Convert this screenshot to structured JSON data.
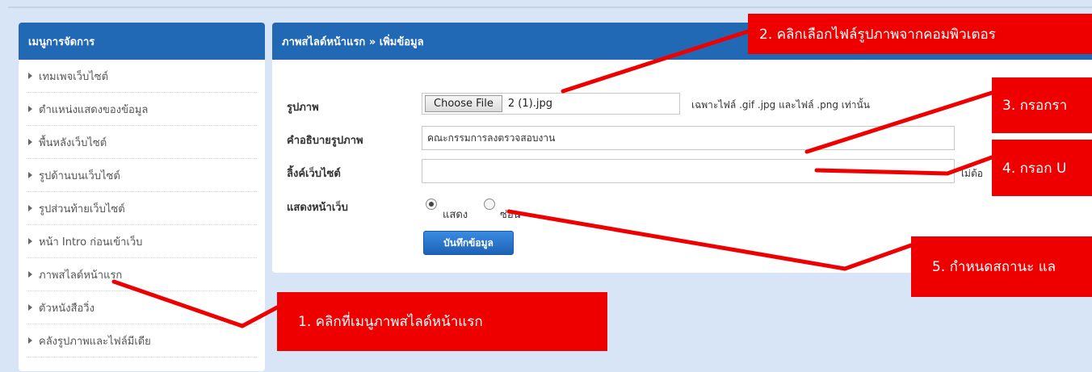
{
  "sidebar": {
    "title": "เมนูการจัดการ",
    "items": [
      {
        "label": "เทมเพจเว็บไซต์"
      },
      {
        "label": "ตำแหน่งแสดงของข้อมูล"
      },
      {
        "label": "พื้นหลังเว็บไซต์"
      },
      {
        "label": "รูปด้านบนเว็บไซต์"
      },
      {
        "label": "รูปส่วนท้ายเว็บไซต์"
      },
      {
        "label": "หน้า Intro ก่อนเข้าเว็บ"
      },
      {
        "label": "ภาพสไลด์หน้าแรก"
      },
      {
        "label": "ตัวหนังสือวิ่ง"
      },
      {
        "label": "คลังรูปภาพและไฟล์มีเดีย"
      }
    ]
  },
  "main": {
    "breadcrumb": "ภาพสไลด์หน้าแรก » เพิ่มข้อมูล",
    "image_label": "รูปภาพ",
    "choose_file": "Choose File",
    "file_name": "2 (1).jpg",
    "file_hint": "เฉพาะไฟล์ .gif .jpg และไฟล์ .png เท่านั้น",
    "desc_label": "คำอธิบายรูปภาพ",
    "desc_value": "คณะกรรมการลงตรวจสอบงาน",
    "link_label": "ลิ้งค์เว็บไซต์",
    "link_value": "",
    "link_hint": "ไม่ต้อ",
    "show_label": "แสดงหน้าเว็บ",
    "show_option": "แสดง",
    "hide_option": "ซ่อน",
    "show_selected": "แสดง",
    "save_button": "บันทึกข้อมูล"
  },
  "annotations": {
    "step1": "1. คลิกที่เมนูภาพสไลด์หน้าแรก",
    "step2": "2. คลิกเลือกไฟล์รูปภาพจากคอมพิวเตอร",
    "step3": "3. กรอกรา",
    "step4": "4. กรอก U",
    "step5": "5. กำหนดสถานะ แล"
  },
  "colors": {
    "header_blue": "#2168b5",
    "background": "#d7e5f7",
    "annotation_red": "#ee0000"
  }
}
